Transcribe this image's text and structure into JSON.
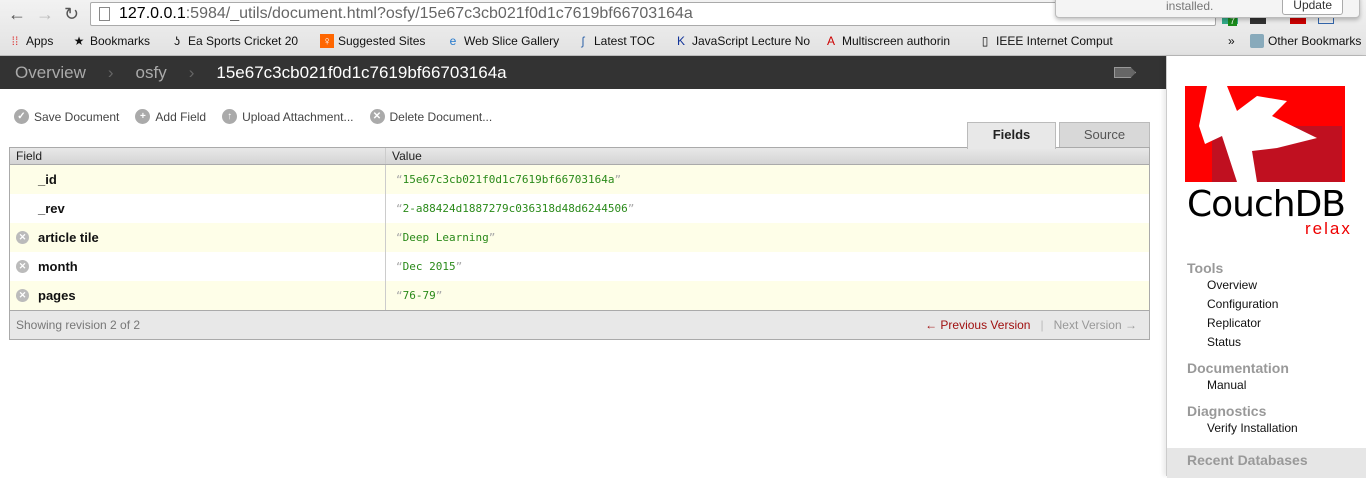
{
  "browser": {
    "url_host": "127.0.0.1",
    "url_rest": ":5984/_utils/document.html?osfy/15e67c3cb021f0d1c7619bf66703164a",
    "bookmarks": [
      "Apps",
      "Bookmarks",
      "Ea Sports Cricket 20",
      "Suggested Sites",
      "Web Slice Gallery",
      "Latest TOC",
      "JavaScript Lecture No",
      "Multiscreen authorin",
      "IEEE Internet Comput"
    ],
    "more": "»",
    "other_bookmarks": "Other Bookmarks",
    "popup_text": "installed.",
    "popup_button": "Update",
    "ext_badge": "7"
  },
  "topbar": {
    "crumbs": [
      "Overview",
      "osfy"
    ],
    "doc_id": "15e67c3cb021f0d1c7619bf66703164a",
    "sep": "›"
  },
  "toolbar": {
    "save": "Save Document",
    "add": "Add Field",
    "upload": "Upload Attachment...",
    "delete": "Delete Document..."
  },
  "tabs": {
    "fields": "Fields",
    "source": "Source"
  },
  "table": {
    "headers": [
      "Field",
      "Value"
    ],
    "rows": [
      {
        "field": "_id",
        "value": "15e67c3cb021f0d1c7619bf66703164a"
      },
      {
        "field": "_rev",
        "value": "2-a88424d1887279c036318d48d6244506"
      },
      {
        "field": "article tile",
        "value": "Deep Learning"
      },
      {
        "field": "month",
        "value": "Dec 2015"
      },
      {
        "field": "pages",
        "value": "76-79"
      }
    ],
    "quote_open": "“",
    "quote_close": "”",
    "footer": "Showing revision 2 of 2",
    "prev": "← Previous Version",
    "divider": "|",
    "next": "Next Version →"
  },
  "sidebar": {
    "logo_text": "CouchDB",
    "logo_tagline": "relax",
    "tools": {
      "title": "Tools",
      "items": [
        "Overview",
        "Configuration",
        "Replicator",
        "Status"
      ]
    },
    "docs": {
      "title": "Documentation",
      "items": [
        "Manual"
      ]
    },
    "diag": {
      "title": "Diagnostics",
      "items": [
        "Verify Installation"
      ]
    },
    "recent": {
      "title": "Recent Databases"
    }
  },
  "colors": {
    "accent": "#e00000",
    "value_green": "#2a8a1a",
    "topbar": "#333333"
  }
}
